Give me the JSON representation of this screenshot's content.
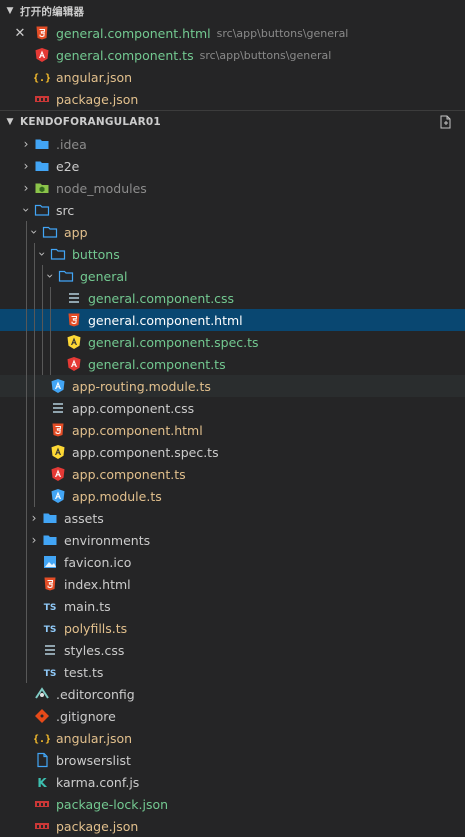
{
  "open_editors": {
    "header": "打开的编辑器",
    "items": [
      {
        "label": "general.component.html",
        "desc": "src\\app\\buttons\\general",
        "icon": "html-icon",
        "color": "green",
        "active": true
      },
      {
        "label": "general.component.ts",
        "desc": "src\\app\\buttons\\general",
        "icon": "angular-red-icon",
        "color": "green"
      },
      {
        "label": "angular.json",
        "desc": "",
        "icon": "json-icon",
        "color": "yellow"
      },
      {
        "label": "package.json",
        "desc": "",
        "icon": "npm-icon",
        "color": "yellow"
      }
    ]
  },
  "project": {
    "header": "KENDOFORANGULAR01",
    "tree": [
      {
        "label": ".idea",
        "icon": "folder-icon",
        "twist": "right",
        "depth": 0,
        "color": "grey"
      },
      {
        "label": "e2e",
        "icon": "folder-icon",
        "twist": "right",
        "depth": 0,
        "color": "white"
      },
      {
        "label": "node_modules",
        "icon": "node-folder-icon",
        "twist": "right",
        "depth": 0,
        "color": "grey"
      },
      {
        "label": "src",
        "icon": "folder-open-icon",
        "twist": "down",
        "depth": 0,
        "color": "white"
      },
      {
        "label": "app",
        "icon": "folder-open-icon",
        "twist": "down",
        "depth": 1,
        "color": "yellow"
      },
      {
        "label": "buttons",
        "icon": "folder-open-icon",
        "twist": "down",
        "depth": 2,
        "color": "green"
      },
      {
        "label": "general",
        "icon": "folder-open-icon",
        "twist": "down",
        "depth": 3,
        "color": "green"
      },
      {
        "label": "general.component.css",
        "icon": "css-icon",
        "depth": 4,
        "color": "green"
      },
      {
        "label": "general.component.html",
        "icon": "html-icon",
        "depth": 4,
        "color": "selwhite",
        "selected": true
      },
      {
        "label": "general.component.spec.ts",
        "icon": "angular-yellow-icon",
        "depth": 4,
        "color": "green"
      },
      {
        "label": "general.component.ts",
        "icon": "angular-red-icon",
        "depth": 4,
        "color": "green"
      },
      {
        "label": "app-routing.module.ts",
        "icon": "angular-blue-icon",
        "depth": 2,
        "color": "yellow",
        "hover": true
      },
      {
        "label": "app.component.css",
        "icon": "css-icon",
        "depth": 2,
        "color": "white"
      },
      {
        "label": "app.component.html",
        "icon": "html-icon",
        "depth": 2,
        "color": "yellow"
      },
      {
        "label": "app.component.spec.ts",
        "icon": "angular-yellow-icon",
        "depth": 2,
        "color": "white"
      },
      {
        "label": "app.component.ts",
        "icon": "angular-red-icon",
        "depth": 2,
        "color": "yellow"
      },
      {
        "label": "app.module.ts",
        "icon": "angular-blue-icon",
        "depth": 2,
        "color": "yellow"
      },
      {
        "label": "assets",
        "icon": "folder-icon",
        "twist": "right",
        "depth": 1,
        "color": "white"
      },
      {
        "label": "environments",
        "icon": "folder-icon",
        "twist": "right",
        "depth": 1,
        "color": "white"
      },
      {
        "label": "favicon.ico",
        "icon": "image-icon",
        "depth": 1,
        "color": "white"
      },
      {
        "label": "index.html",
        "icon": "html-icon",
        "depth": 1,
        "color": "white"
      },
      {
        "label": "main.ts",
        "icon": "ts-icon",
        "depth": 1,
        "color": "white"
      },
      {
        "label": "polyfills.ts",
        "icon": "ts-icon",
        "depth": 1,
        "color": "yellow"
      },
      {
        "label": "styles.css",
        "icon": "css-icon",
        "depth": 1,
        "color": "white"
      },
      {
        "label": "test.ts",
        "icon": "ts-icon",
        "depth": 1,
        "color": "white"
      },
      {
        "label": ".editorconfig",
        "icon": "editorconfig-icon",
        "depth": 0,
        "color": "white"
      },
      {
        "label": ".gitignore",
        "icon": "git-icon",
        "depth": 0,
        "color": "white"
      },
      {
        "label": "angular.json",
        "icon": "json-icon",
        "depth": 0,
        "color": "yellow"
      },
      {
        "label": "browserslist",
        "icon": "file-icon",
        "depth": 0,
        "color": "white"
      },
      {
        "label": "karma.conf.js",
        "icon": "karma-icon",
        "depth": 0,
        "color": "white"
      },
      {
        "label": "package-lock.json",
        "icon": "npm-icon",
        "depth": 0,
        "color": "green"
      },
      {
        "label": "package.json",
        "icon": "npm-icon",
        "depth": 0,
        "color": "yellow"
      }
    ]
  },
  "colors": {
    "background": "#252526",
    "selection": "#094771",
    "hover": "#2a2d2e",
    "git_modified": "#e2c08d",
    "git_added": "#73c991",
    "ignored": "#8c8c8c"
  }
}
